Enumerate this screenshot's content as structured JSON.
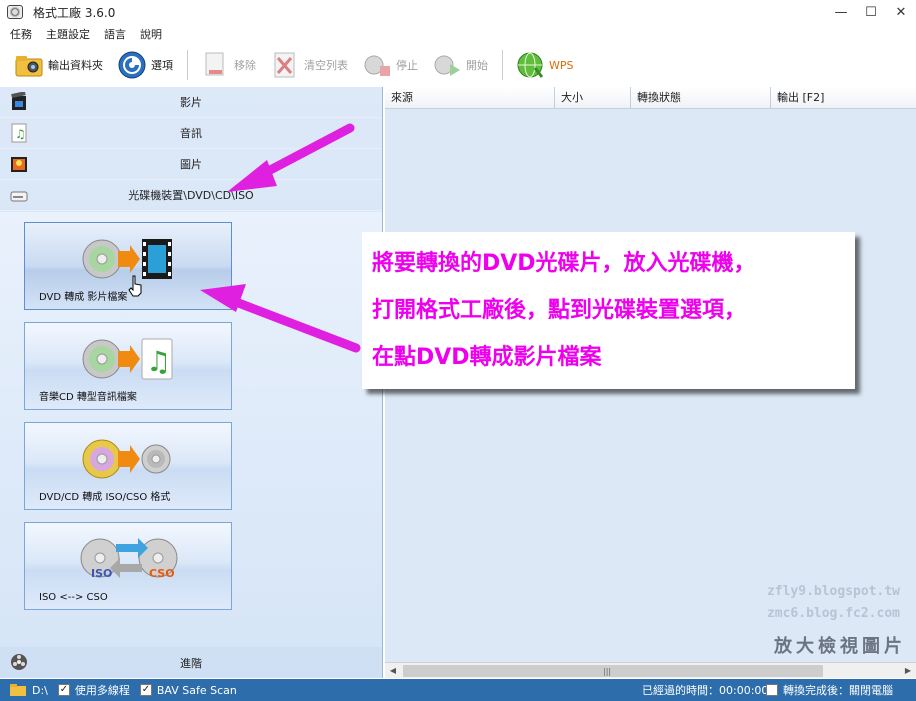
{
  "window": {
    "title": "格式工廠 3.6.0",
    "controls": [
      "—",
      "☐",
      "✕"
    ]
  },
  "menu": [
    "任務",
    "主題設定",
    "語言",
    "說明"
  ],
  "toolbar": {
    "output_folder": "輸出資料夾",
    "options": "選項",
    "remove": "移除",
    "clear_list": "清空列表",
    "stop": "停止",
    "start": "開始",
    "wps": "WPS"
  },
  "categories": [
    {
      "label": "影片",
      "icon": "video-icon"
    },
    {
      "label": "音訊",
      "icon": "audio-icon"
    },
    {
      "label": "圖片",
      "icon": "picture-icon"
    },
    {
      "label": "光碟機裝置\\DVD\\CD\\ISO",
      "icon": "disc-drive-icon"
    }
  ],
  "tasks": [
    {
      "label": "DVD 轉成 影片檔案"
    },
    {
      "label": "音樂CD 轉型音訊檔案"
    },
    {
      "label": "DVD/CD 轉成 ISO/CSO 格式"
    },
    {
      "label": "ISO <--> CSO"
    }
  ],
  "iso_badge": "ISO",
  "cso_badge": "CSO",
  "advanced": "進階",
  "table": {
    "columns": [
      "來源",
      "大小",
      "轉換狀態",
      "輸出 [F2]"
    ]
  },
  "scroll_grip": "|||",
  "status": {
    "drive": "D:\\",
    "multithread": "使用多線程",
    "bav": "BAV Safe Scan",
    "elapsed_label": "已經過的時間：",
    "elapsed_value": "00:00:00",
    "after_done": "轉換完成後：關閉電腦"
  },
  "annotation": [
    "將要轉換的DVD光碟片，放入光碟機，",
    "打開格式工廠後，點到光碟裝置選項，",
    "在點DVD轉成影片檔案"
  ],
  "watermark": {
    "line1": "zfly9.blogspot.tw",
    "line2": "zmc6.blog.fc2.com",
    "line3": "放大檢視圖片"
  },
  "colors": {
    "annotation": "#ee00ee",
    "arrow": "#e020e0",
    "statusbar": "#2d6dab"
  }
}
